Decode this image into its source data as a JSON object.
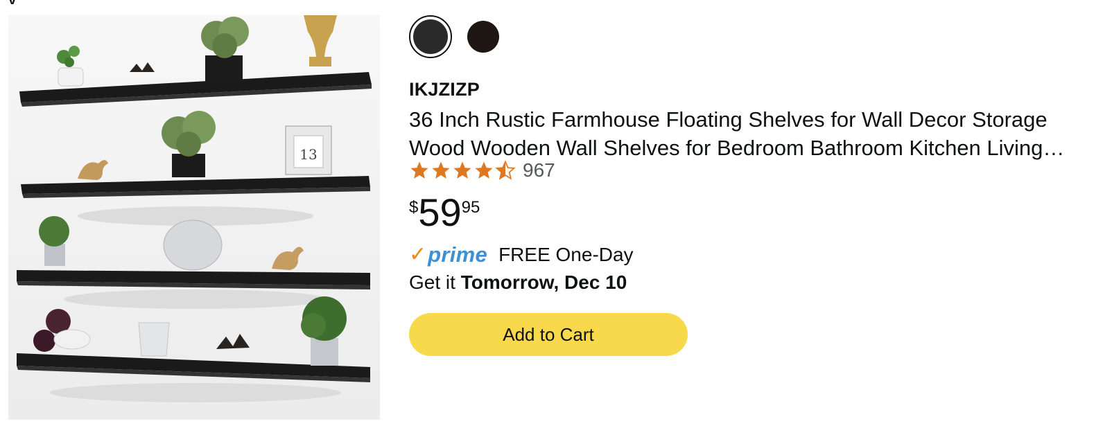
{
  "product": {
    "brand": "IKJZIZP",
    "title_line1": "36 Inch Rustic Farmhouse Floating Shelves for Wall Decor Storage",
    "title_line2": "Wood Wooden Wall Shelves for Bedroom Bathroom Kitchen Living…",
    "rating": {
      "stars": 4.5,
      "max_stars": 5,
      "count": "967",
      "star_color": "#de7921"
    },
    "price": {
      "symbol": "$",
      "whole": "59",
      "fraction": "95"
    },
    "prime": {
      "logo_check": "✓",
      "logo_word": "prime",
      "text": "FREE One-Day",
      "check_color": "#f08804",
      "word_color": "#3d8fd6"
    },
    "delivery": {
      "prefix": "Get it ",
      "date": "Tomorrow, Dec 10"
    },
    "add_to_cart_label": "Add to Cart",
    "button_color": "#f8d94c",
    "swatches": [
      {
        "color": "#2a2a2a",
        "selected": true
      },
      {
        "color": "#1e1612",
        "selected": false
      }
    ]
  }
}
